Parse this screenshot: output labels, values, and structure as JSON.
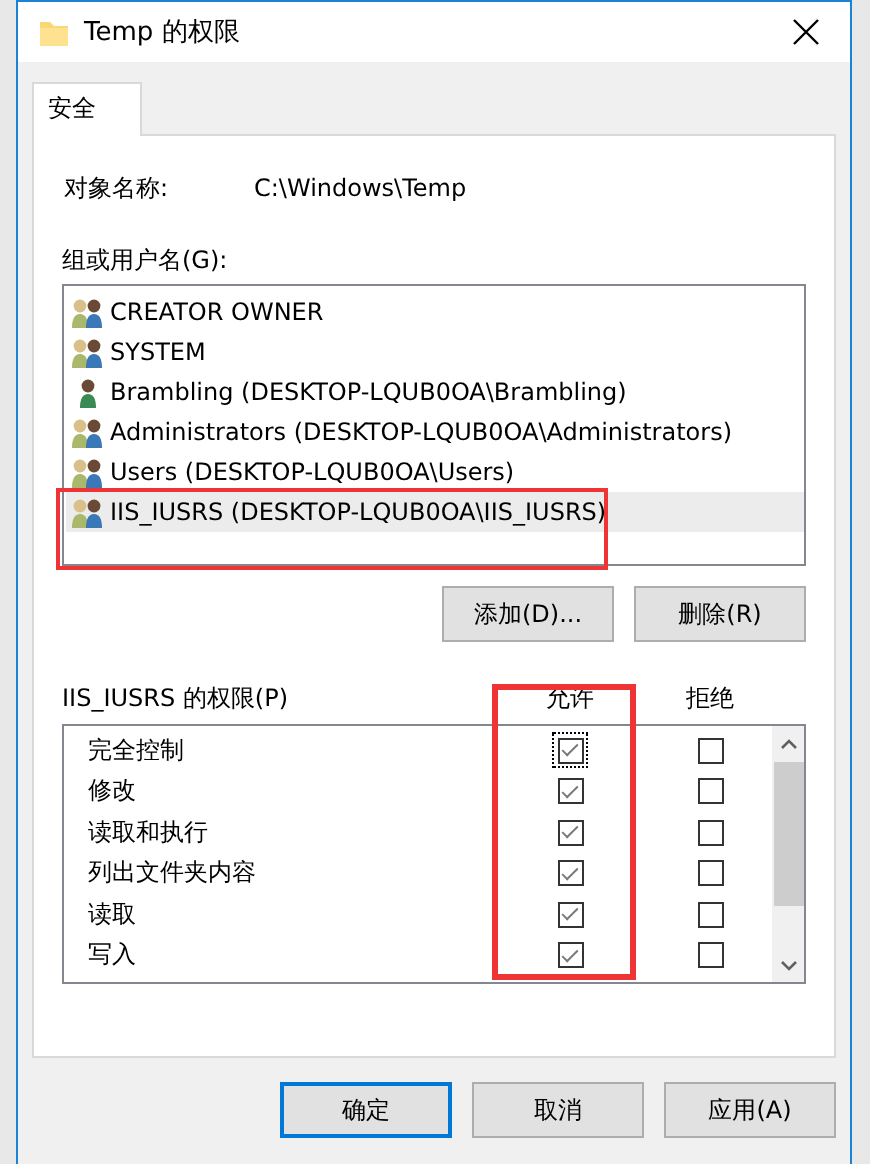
{
  "window": {
    "title": "Temp 的权限"
  },
  "tabs": [
    {
      "label": "安全",
      "selected": true
    }
  ],
  "object_name": {
    "label": "对象名称:",
    "value": "C:\\Windows\\Temp"
  },
  "users": {
    "label": "组或用户名(G):",
    "items": [
      {
        "name": "CREATOR OWNER",
        "kind": "group",
        "selected": false,
        "highlighted": false
      },
      {
        "name": "SYSTEM",
        "kind": "group",
        "selected": false,
        "highlighted": false
      },
      {
        "name": "Brambling (DESKTOP-LQUB0OA\\Brambling)",
        "kind": "user",
        "selected": false,
        "highlighted": false
      },
      {
        "name": "Administrators (DESKTOP-LQUB0OA\\Administrators)",
        "kind": "group",
        "selected": false,
        "highlighted": false
      },
      {
        "name": "Users (DESKTOP-LQUB0OA\\Users)",
        "kind": "group",
        "selected": false,
        "highlighted": false
      },
      {
        "name": "IIS_IUSRS (DESKTOP-LQUB0OA\\IIS_IUSRS)",
        "kind": "group",
        "selected": true,
        "highlighted": true
      }
    ]
  },
  "user_buttons": [
    "添加(D)...",
    "删除(R)"
  ],
  "permissions": {
    "label": "IIS_IUSRS 的权限(P)",
    "allow_header": "允许",
    "deny_header": "拒绝",
    "allow_highlighted": true,
    "rows": [
      {
        "name": "完全控制",
        "allow": true,
        "deny": false,
        "focused": true
      },
      {
        "name": "修改",
        "allow": true,
        "deny": false,
        "focused": false
      },
      {
        "name": "读取和执行",
        "allow": true,
        "deny": false,
        "focused": false
      },
      {
        "name": "列出文件夹内容",
        "allow": true,
        "deny": false,
        "focused": false
      },
      {
        "name": "读取",
        "allow": true,
        "deny": false,
        "focused": false
      },
      {
        "name": "写入",
        "allow": true,
        "deny": false,
        "focused": false
      }
    ]
  },
  "buttons": [
    {
      "label": "确定",
      "default": true
    },
    {
      "label": "取消",
      "default": false
    },
    {
      "label": "应用(A)",
      "default": false
    }
  ]
}
